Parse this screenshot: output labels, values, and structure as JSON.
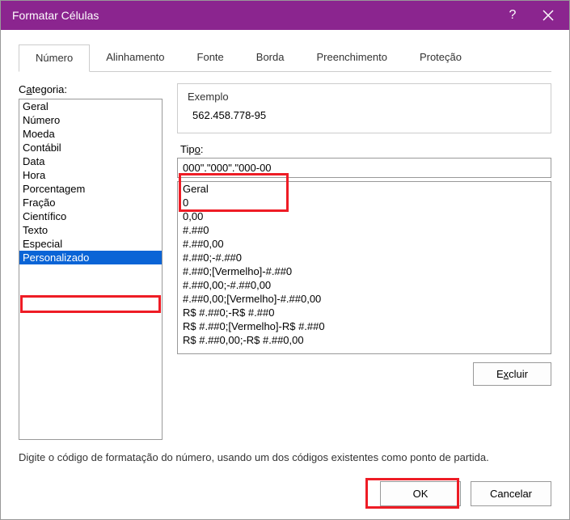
{
  "window": {
    "title": "Formatar Células",
    "help_label": "?",
    "close_label": "×"
  },
  "tabs": {
    "items": [
      {
        "label": "Número"
      },
      {
        "label": "Alinhamento"
      },
      {
        "label": "Fonte"
      },
      {
        "label": "Borda"
      },
      {
        "label": "Preenchimento"
      },
      {
        "label": "Proteção"
      }
    ],
    "active_index": 0
  },
  "category": {
    "label_pre": "C",
    "label_und": "a",
    "label_post": "tegoria:",
    "items": [
      "Geral",
      "Número",
      "Moeda",
      "Contábil",
      "Data",
      "Hora",
      "Porcentagem",
      "Fração",
      "Científico",
      "Texto",
      "Especial",
      "Personalizado"
    ],
    "selected_index": 11
  },
  "sample": {
    "legend": "Exemplo",
    "value": "562.458.778-95"
  },
  "type": {
    "label_pre": "Tip",
    "label_und": "o",
    "label_post": ":",
    "value": "000\".\"000\".\"000-00"
  },
  "formats": {
    "items": [
      "Geral",
      "0",
      "0,00",
      "#.##0",
      "#.##0,00",
      "#.##0;-#.##0",
      "#.##0;[Vermelho]-#.##0",
      "#.##0,00;-#.##0,00",
      "#.##0,00;[Vermelho]-#.##0,00",
      "R$ #.##0;-R$ #.##0",
      "R$ #.##0;[Vermelho]-R$ #.##0",
      "R$ #.##0,00;-R$ #.##0,00"
    ]
  },
  "buttons": {
    "delete_pre": "E",
    "delete_und": "x",
    "delete_post": "cluir",
    "ok": "OK",
    "cancel": "Cancelar"
  },
  "hint": "Digite o código de formatação do número, usando um dos códigos existentes como ponto de partida."
}
